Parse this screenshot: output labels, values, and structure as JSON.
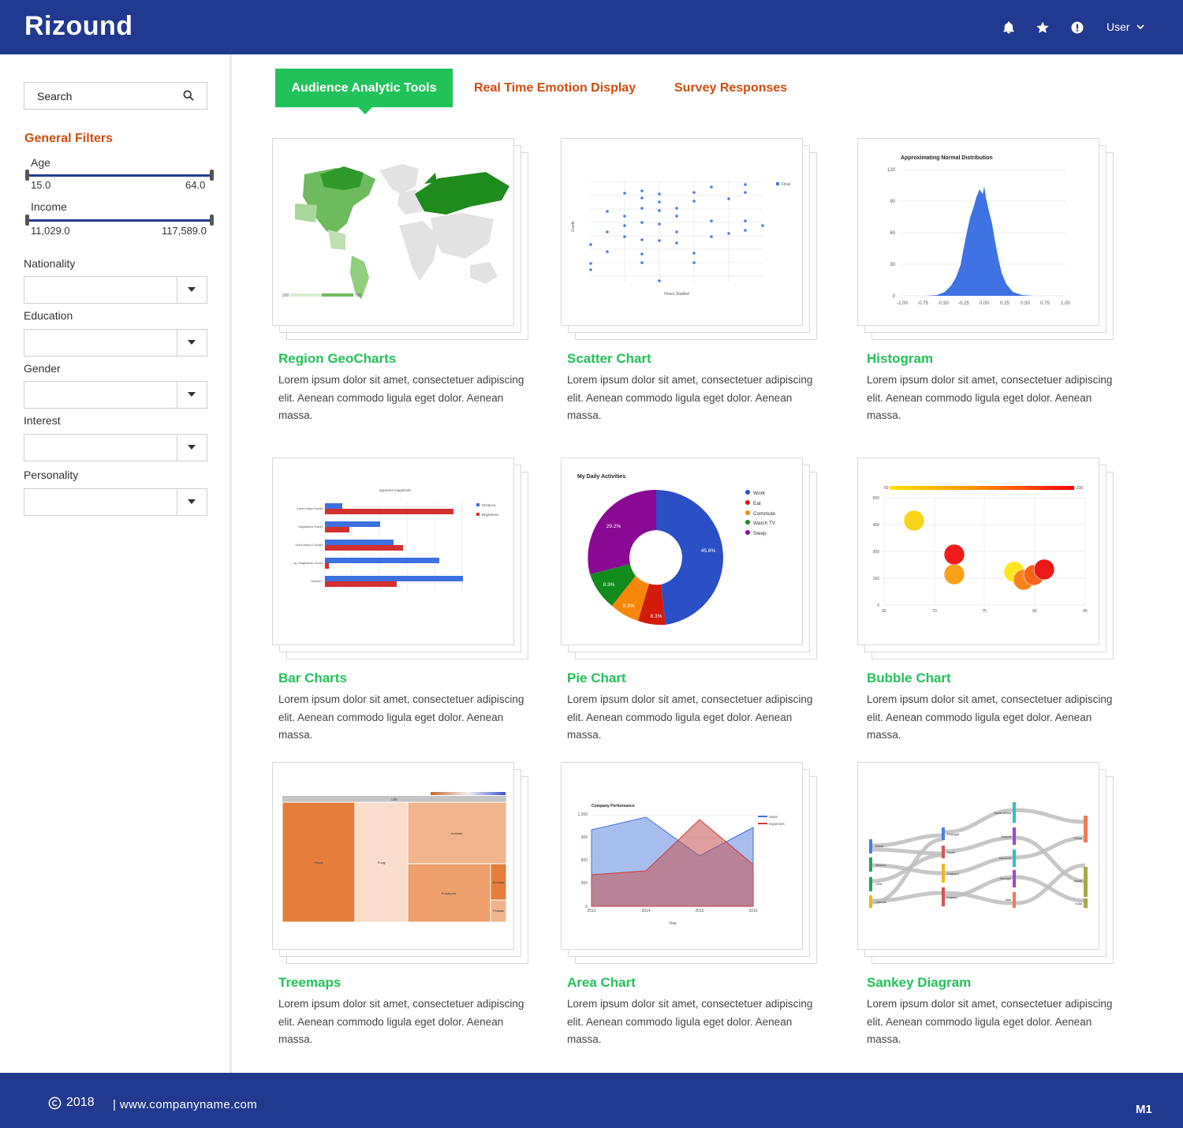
{
  "app": {
    "title": "Rizound"
  },
  "header": {
    "user_label": "User"
  },
  "sidebar": {
    "search_placeholder": "Search",
    "filters_title": "General Filters",
    "age": {
      "label": "Age",
      "min": "15.0",
      "max": "64.0"
    },
    "income": {
      "label": "Income",
      "min": "11,029.0",
      "max": "117,589.0"
    },
    "dropdowns": [
      {
        "label": "Nationality",
        "value": ""
      },
      {
        "label": "Education",
        "value": ""
      },
      {
        "label": "Gender",
        "value": ""
      },
      {
        "label": "Interest",
        "value": ""
      },
      {
        "label": "Personality",
        "value": ""
      }
    ]
  },
  "tabs": [
    {
      "label": "Audience Analytic Tools",
      "active": true
    },
    {
      "label": "Real Time Emotion Display",
      "active": false
    },
    {
      "label": "Survey Responses",
      "active": false
    }
  ],
  "cards": [
    {
      "title": "Region GeoCharts",
      "desc": "Lorem ipsum dolor sit amet, consectetuer adipiscing elit. Aenean commodo ligula eget dolor. Aenean massa."
    },
    {
      "title": "Scatter Chart",
      "desc": "Lorem ipsum dolor sit amet, consectetuer adipiscing elit. Aenean commodo ligula eget dolor. Aenean massa."
    },
    {
      "title": "Histogram",
      "desc": "Lorem ipsum dolor sit amet, consectetuer adipiscing elit. Aenean commodo ligula eget dolor. Aenean massa."
    },
    {
      "title": "Bar Charts",
      "desc": "Lorem ipsum dolor sit amet, consectetuer adipiscing elit. Aenean commodo ligula eget dolor. Aenean massa."
    },
    {
      "title": "Pie Chart",
      "desc": "Lorem ipsum dolor sit amet, consectetuer adipiscing elit. Aenean commodo ligula eget dolor. Aenean massa."
    },
    {
      "title": "Bubble Chart",
      "desc": "Lorem ipsum dolor sit amet, consectetuer adipiscing elit. Aenean commodo ligula eget dolor. Aenean massa."
    },
    {
      "title": "Treemaps",
      "desc": "Lorem ipsum dolor sit amet, consectetuer adipiscing elit. Aenean commodo ligula eget dolor. Aenean massa."
    },
    {
      "title": "Area Chart",
      "desc": "Lorem ipsum dolor sit amet, consectetuer adipiscing elit. Aenean commodo ligula eget dolor. Aenean massa."
    },
    {
      "title": "Sankey Diagram",
      "desc": "Lorem ipsum dolor sit amet, consectetuer adipiscing elit. Aenean commodo ligula eget dolor. Aenean massa."
    }
  ],
  "thumbnails": {
    "histogram_title": "Approximating Normal Distribution",
    "histogram_y_ticks": [
      "120",
      "90",
      "60",
      "30",
      "0"
    ],
    "histogram_x_ticks": [
      "-1.00",
      "-0.75",
      "-0.50",
      "-0.25",
      "0.00",
      "0.25",
      "0.50",
      "0.75",
      "1.00"
    ],
    "pie_title": "My Daily Activities",
    "pie_legend": [
      "Work",
      "Eat",
      "Commute",
      "Watch TV",
      "Sleep"
    ],
    "pie_labels": [
      "45.8%",
      "8.3%",
      "8.3%",
      "8.3%",
      "29.2%"
    ],
    "bubble_scale": [
      "60",
      "230"
    ],
    "bubble_y_ticks": [
      "600",
      "450",
      "300",
      "150",
      "0"
    ],
    "bubble_x_ticks": [
      "65",
      "70",
      "75",
      "80",
      "85"
    ],
    "area_title": "Company Performance",
    "area_legend": [
      "Sales",
      "Expenses"
    ],
    "area_y_ticks": [
      "1,200",
      "900",
      "600",
      "300",
      "0"
    ],
    "area_x_ticks": [
      "2013",
      "2014",
      "2015",
      "2016"
    ],
    "area_x_label": "Year",
    "geo_legend": [
      "200",
      "700"
    ],
    "treemap_labels": [
      "Life",
      "Plants",
      "Fungi",
      "Animals",
      "Eukaryota",
      "Archaea",
      "Protista"
    ],
    "bar_legend": [
      "Distance",
      "Brightness"
    ],
    "bar_title": "apparent magnitude",
    "bar_categories": [
      "Canis Major Dwarf",
      "Sagittarius Dwarf",
      "Ursa Major II Dwarf",
      "Lg. Magellanic Cloud",
      "Bootes I"
    ],
    "scatter_legend": "Final",
    "scatter_x_label": "Hours Studied",
    "scatter_y_label": "Grade",
    "sankey_nodes": [
      "Brazil",
      "Mexico",
      "USA",
      "Canada",
      "Portugal",
      "Spain",
      "England",
      "France",
      "South Africa",
      "Angola",
      "Morocco",
      "Senegal",
      "Mali",
      "China",
      "Japan",
      "India"
    ]
  },
  "footer": {
    "year": "2018",
    "site": "|  www.companyname.com",
    "version": "M1"
  },
  "colors": {
    "primary": "#213a8f",
    "accent_green": "#22c25a",
    "accent_orange": "#d24b0c"
  }
}
